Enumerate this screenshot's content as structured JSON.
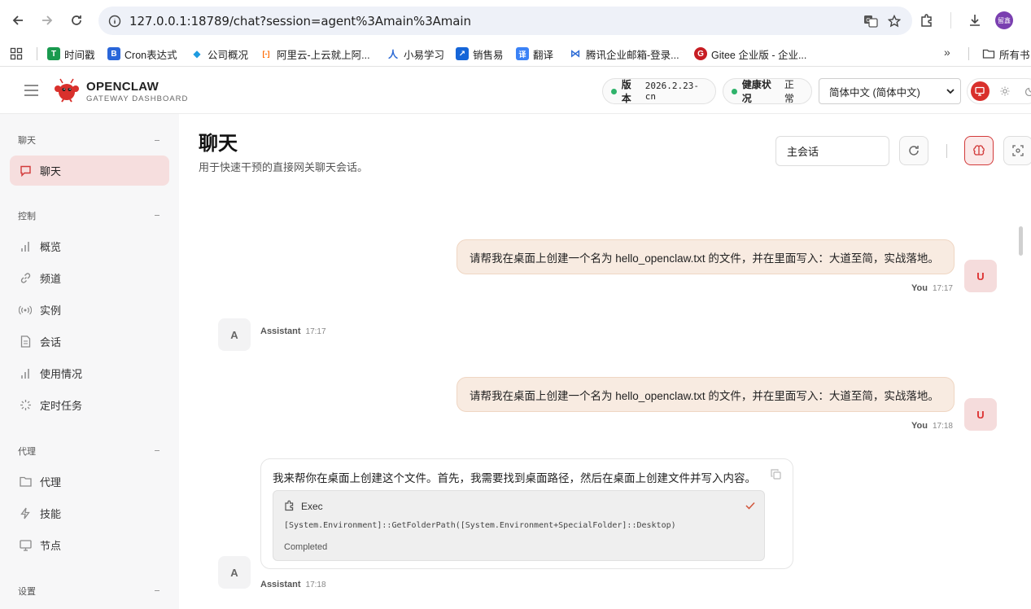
{
  "browser": {
    "url": "127.0.0.1:18789/chat?session=agent%3Amain%3Amain",
    "profile_initials": "留鑫",
    "bookmarks": [
      {
        "label": "时间戳",
        "color": "#1a9a4f",
        "glyph": "T"
      },
      {
        "label": "Cron表达式",
        "color": "#2a66d9",
        "glyph": "B"
      },
      {
        "label": "公司概况",
        "color": "#1e9be0",
        "glyph": "◆"
      },
      {
        "label": "阿里云-上云就上阿...",
        "color": "#ff6a00",
        "glyph": "[-]"
      },
      {
        "label": "小易学习",
        "color": "#2d6bd5",
        "glyph": "人"
      },
      {
        "label": "销售易",
        "color": "#1565d8",
        "glyph": "↗"
      },
      {
        "label": "翻译",
        "color": "#3b82f6",
        "glyph": "译"
      },
      {
        "label": "腾讯企业邮箱-登录...",
        "color": "#2d6bd5",
        "glyph": "⋈"
      },
      {
        "label": "Gitee 企业版 - 企业...",
        "color": "#c71d23",
        "glyph": "G"
      }
    ],
    "more_bookmarks": "»",
    "all_bookmarks": "所有书"
  },
  "app": {
    "brand_title": "OPENCLAW",
    "brand_subtitle": "GATEWAY DASHBOARD",
    "version_label": "版本",
    "version_value": "2026.2.23-cn",
    "health_label": "健康状况",
    "health_value": "正常",
    "language": "简体中文 (简体中文)",
    "status_color": "#2fb36b",
    "accent_color": "#d23a3a"
  },
  "sidebar": {
    "sections": [
      {
        "title": "聊天",
        "items": [
          {
            "label": "聊天",
            "icon": "chat-icon",
            "active": true
          }
        ]
      },
      {
        "title": "控制",
        "items": [
          {
            "label": "概览",
            "icon": "bar-chart-icon"
          },
          {
            "label": "频道",
            "icon": "link-icon"
          },
          {
            "label": "实例",
            "icon": "broadcast-icon"
          },
          {
            "label": "会话",
            "icon": "document-icon"
          },
          {
            "label": "使用情况",
            "icon": "bar-chart-icon"
          },
          {
            "label": "定时任务",
            "icon": "loader-icon"
          }
        ]
      },
      {
        "title": "代理",
        "items": [
          {
            "label": "代理",
            "icon": "folder-icon"
          },
          {
            "label": "技能",
            "icon": "lightning-icon"
          },
          {
            "label": "节点",
            "icon": "monitor-icon"
          }
        ]
      },
      {
        "title": "设置",
        "items": []
      }
    ]
  },
  "chat": {
    "title": "聊天",
    "subtitle": "用于快速干预的直接网关聊天会话。",
    "session_value": "主会话",
    "messages": [
      {
        "role": "user",
        "text": "请帮我在桌面上创建一个名为 hello_openclaw.txt 的文件，并在里面写入：大道至简，实战落地。",
        "sender": "You",
        "time": "17:17",
        "avatar": "U"
      },
      {
        "role": "assistant",
        "text": "",
        "sender": "Assistant",
        "time": "17:17",
        "avatar": "A"
      },
      {
        "role": "user",
        "text": "请帮我在桌面上创建一个名为 hello_openclaw.txt 的文件，并在里面写入：大道至简，实战落地。",
        "sender": "You",
        "time": "17:18",
        "avatar": "U"
      },
      {
        "role": "assistant",
        "text": "我来帮你在桌面上创建这个文件。首先，我需要找到桌面路径，然后在桌面上创建文件并写入内容。",
        "sender": "Assistant",
        "time": "17:18",
        "avatar": "A",
        "tool": {
          "name": "Exec",
          "command": "[System.Environment]::GetFolderPath([System.Environment+SpecialFolder]::Desktop)",
          "status": "Completed"
        }
      }
    ]
  }
}
